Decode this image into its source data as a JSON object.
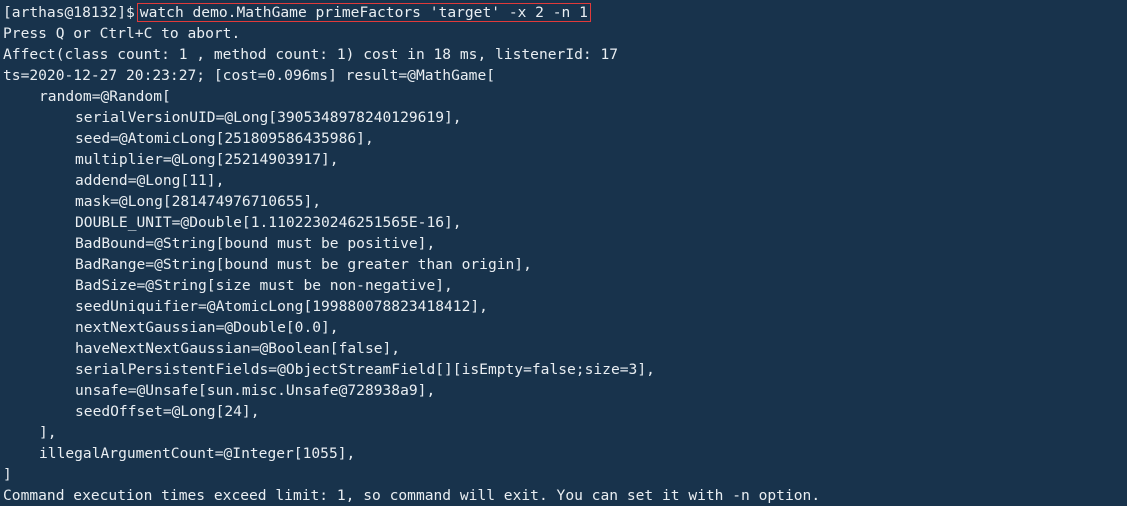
{
  "terminal": {
    "prompt": "[arthas@18132]$",
    "command": "watch demo.MathGame primeFactors 'target' -x 2 -n 1",
    "lines": [
      "Press Q or Ctrl+C to abort.",
      "Affect(class count: 1 , method count: 1) cost in 18 ms, listenerId: 17",
      "ts=2020-12-27 20:23:27; [cost=0.096ms] result=@MathGame["
    ],
    "random_open": "random=@Random[",
    "random_fields": [
      "serialVersionUID=@Long[3905348978240129619],",
      "seed=@AtomicLong[251809586435986],",
      "multiplier=@Long[25214903917],",
      "addend=@Long[11],",
      "mask=@Long[281474976710655],",
      "DOUBLE_UNIT=@Double[1.1102230246251565E-16],",
      "BadBound=@String[bound must be positive],",
      "BadRange=@String[bound must be greater than origin],",
      "BadSize=@String[size must be non-negative],",
      "seedUniquifier=@AtomicLong[199880078823418412],",
      "nextNextGaussian=@Double[0.0],",
      "haveNextNextGaussian=@Boolean[false],",
      "serialPersistentFields=@ObjectStreamField[][isEmpty=false;size=3],",
      "unsafe=@Unsafe[sun.misc.Unsafe@728938a9],",
      "seedOffset=@Long[24],"
    ],
    "random_close": "],",
    "illegal_count": "illegalArgumentCount=@Integer[1055],",
    "result_close": "]",
    "footer": "Command execution times exceed limit: 1, so command will exit. You can set it with -n option."
  },
  "colors": {
    "background": "#18334c",
    "text": "#e9eef2",
    "highlight_border": "#e03a3a"
  }
}
